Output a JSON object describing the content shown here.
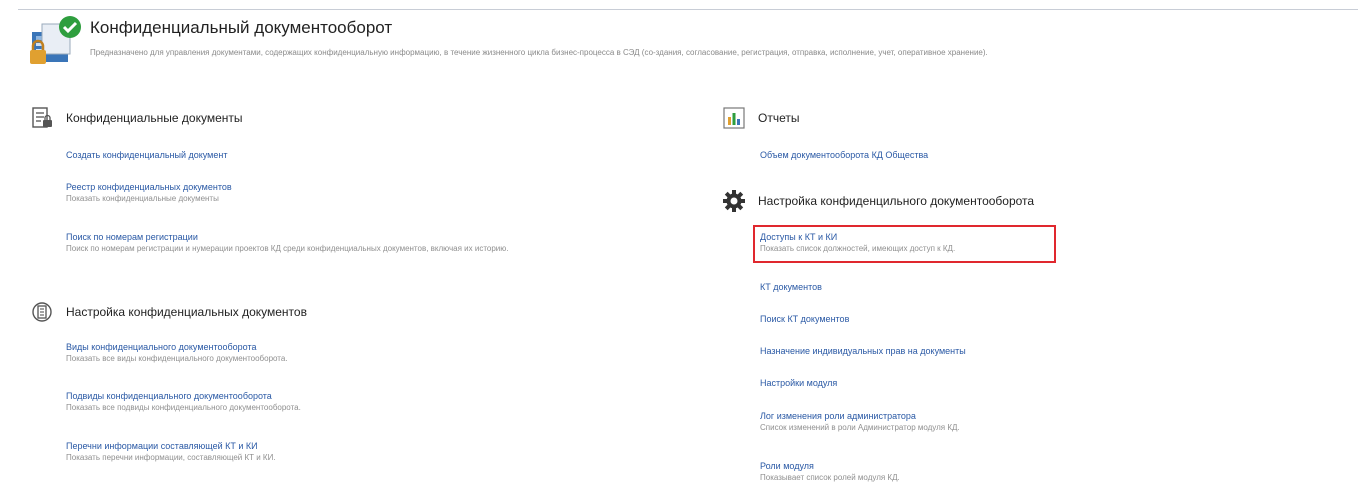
{
  "header": {
    "title": "Конфиденциальный документооборот",
    "description": "Предназначено для управления документами, содержащих конфиденциальную информацию, в течение жизненного цикла бизнес-процесса в СЭД (со-здания, согласование, регистрация, отправка, исполнение, учет, оперативное хранение)."
  },
  "left": {
    "documents": {
      "title": "Конфиденциальные документы",
      "icon": "document-list-icon",
      "items": [
        {
          "link": "Создать конфиденциальный документ",
          "sub": ""
        },
        {
          "link": "Реестр конфиденциальных документов",
          "sub": "Показать конфиденциальные документы"
        },
        {
          "link": "Поиск по номерам регистрации",
          "sub": "Поиск по номерам регистрации и нумерации проектов КД среди конфиденциальных документов, включая их историю."
        }
      ]
    },
    "settings": {
      "title": "Настройка конфиденциальных документов",
      "icon": "document-settings-icon",
      "items": [
        {
          "link": "Виды конфиденциального документооборота",
          "sub": "Показать все виды конфиденциального документооборота."
        },
        {
          "link": "Подвиды конфиденциального документооборота",
          "sub": "Показать все подвиды конфиденциального документооборота."
        },
        {
          "link": "Перечни информации составляющей КТ и КИ",
          "sub": "Показать перечни информации, составляющей КТ и КИ."
        }
      ]
    }
  },
  "right": {
    "reports": {
      "title": "Отчеты",
      "icon": "bar-chart-icon",
      "items": [
        {
          "link": "Объем документооборота КД Общества",
          "sub": ""
        }
      ]
    },
    "config": {
      "title": "Настройка конфиденцильного документооборота",
      "icon": "gear-icon",
      "items": [
        {
          "link": "Доступы к КТ и КИ",
          "sub": "Показать список должностей, имеющих доступ к КД."
        },
        {
          "link": "КТ документов",
          "sub": ""
        },
        {
          "link": "Поиск КТ документов",
          "sub": ""
        },
        {
          "link": "Назначение индивидуальных прав на документы",
          "sub": ""
        },
        {
          "link": "Настройки модуля",
          "sub": ""
        },
        {
          "link": "Лог изменения роли администратора",
          "sub": "Список изменений в роли Администратор модуля КД."
        },
        {
          "link": "Роли модуля",
          "sub": "Показывает список ролей модуля КД."
        }
      ]
    }
  },
  "colors": {
    "link": "#2a59a5",
    "highlight": "#e0282e",
    "logo_green": "#2e9e3e"
  }
}
